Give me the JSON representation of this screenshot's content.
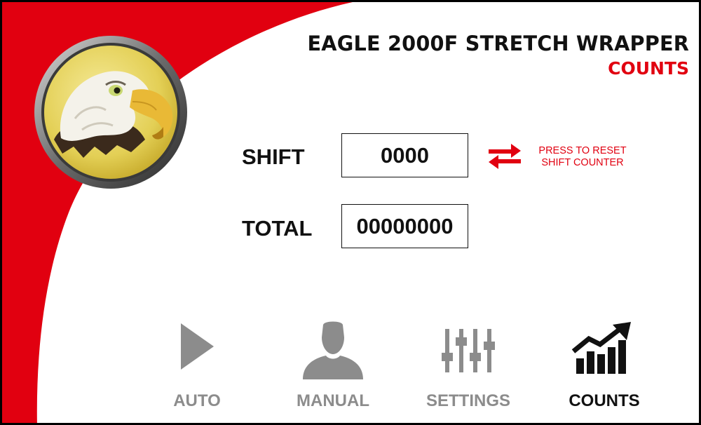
{
  "header": {
    "title": "EAGLE 2000F STRETCH WRAPPER",
    "subtitle": "COUNTS"
  },
  "logo": {
    "icon": "eagle-icon"
  },
  "counters": {
    "shift": {
      "label": "SHIFT",
      "value": "0000"
    },
    "total": {
      "label": "TOTAL",
      "value": "00000000"
    },
    "reset": {
      "icon": "reset-arrows-icon",
      "line1": "PRESS TO RESET",
      "line2": "SHIFT COUNTER"
    }
  },
  "nav": {
    "items": [
      {
        "label": "AUTO",
        "icon": "play-icon",
        "active": false
      },
      {
        "label": "MANUAL",
        "icon": "person-icon",
        "active": false
      },
      {
        "label": "SETTINGS",
        "icon": "sliders-icon",
        "active": false
      },
      {
        "label": "COUNTS",
        "icon": "chart-icon",
        "active": true
      }
    ]
  },
  "colors": {
    "brand_red": "#e10010",
    "inactive_gray": "#8c8c8c",
    "active_black": "#111111",
    "logo_gold": "#e8d35a"
  }
}
